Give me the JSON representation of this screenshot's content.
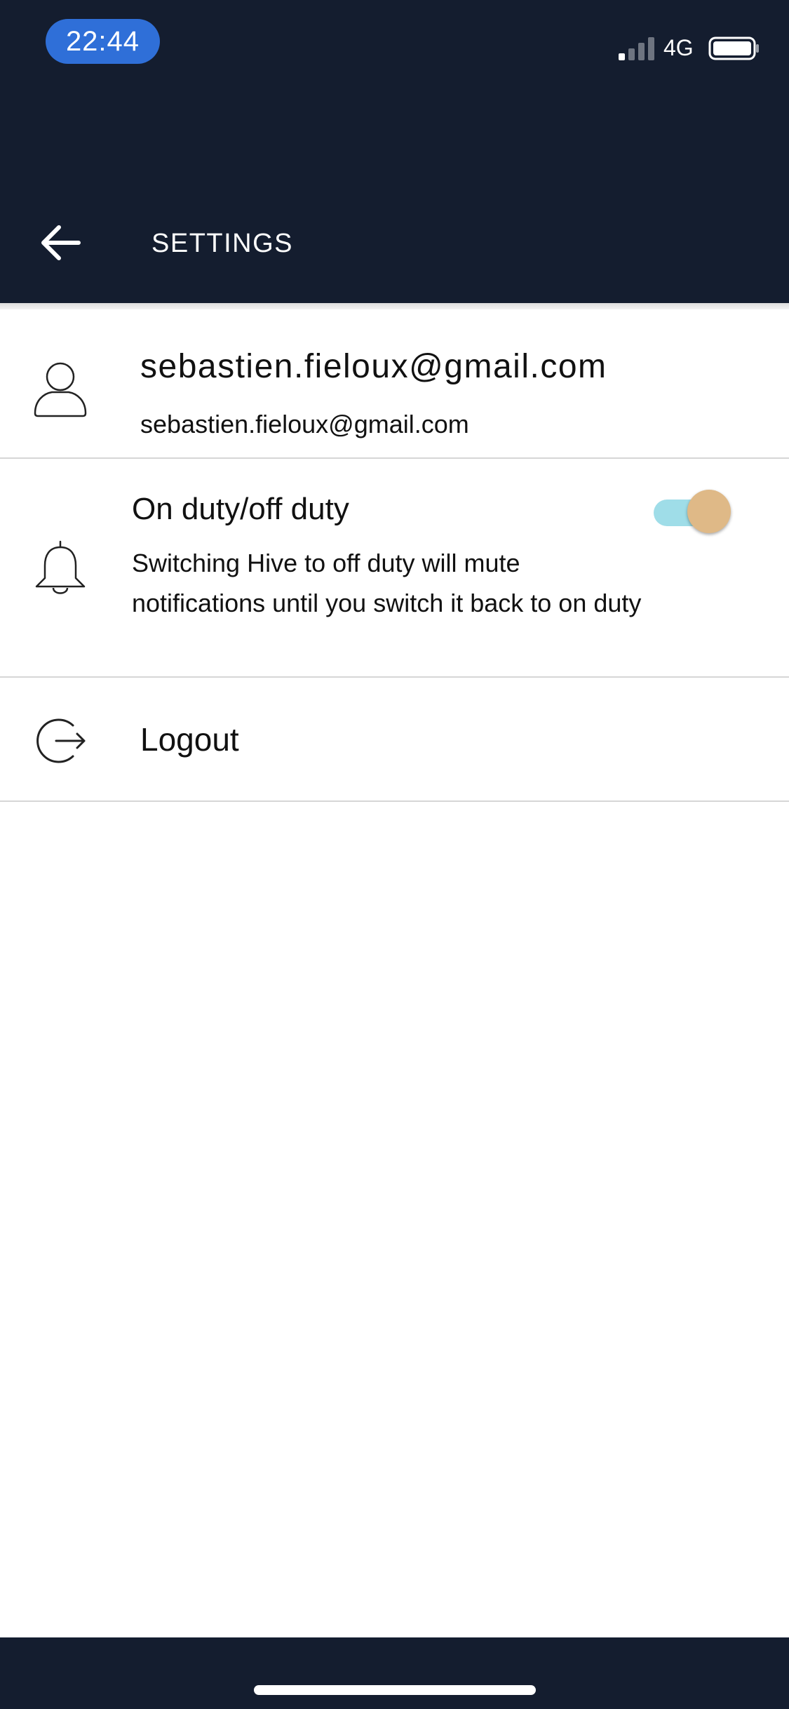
{
  "status_bar": {
    "time": "22:44",
    "network": "4G"
  },
  "header": {
    "title": "SETTINGS",
    "back_icon": "arrow-left-icon"
  },
  "account": {
    "icon": "user-icon",
    "title": "sebastien.fieloux@gmail.com",
    "subtitle": "sebastien.fieloux@gmail.com"
  },
  "duty": {
    "icon": "bell-icon",
    "title": "On duty/off duty",
    "description": "Switching Hive to off duty will mute notifications until you switch it back to on duty",
    "toggle_on": true
  },
  "logout": {
    "icon": "logout-icon",
    "label": "Logout"
  },
  "colors": {
    "header_bg": "#141d2f",
    "status_time_bg": "#2f6fd8",
    "toggle_track": "#9fdde8",
    "toggle_thumb": "#dfb987",
    "divider": "#d6d6d6"
  }
}
